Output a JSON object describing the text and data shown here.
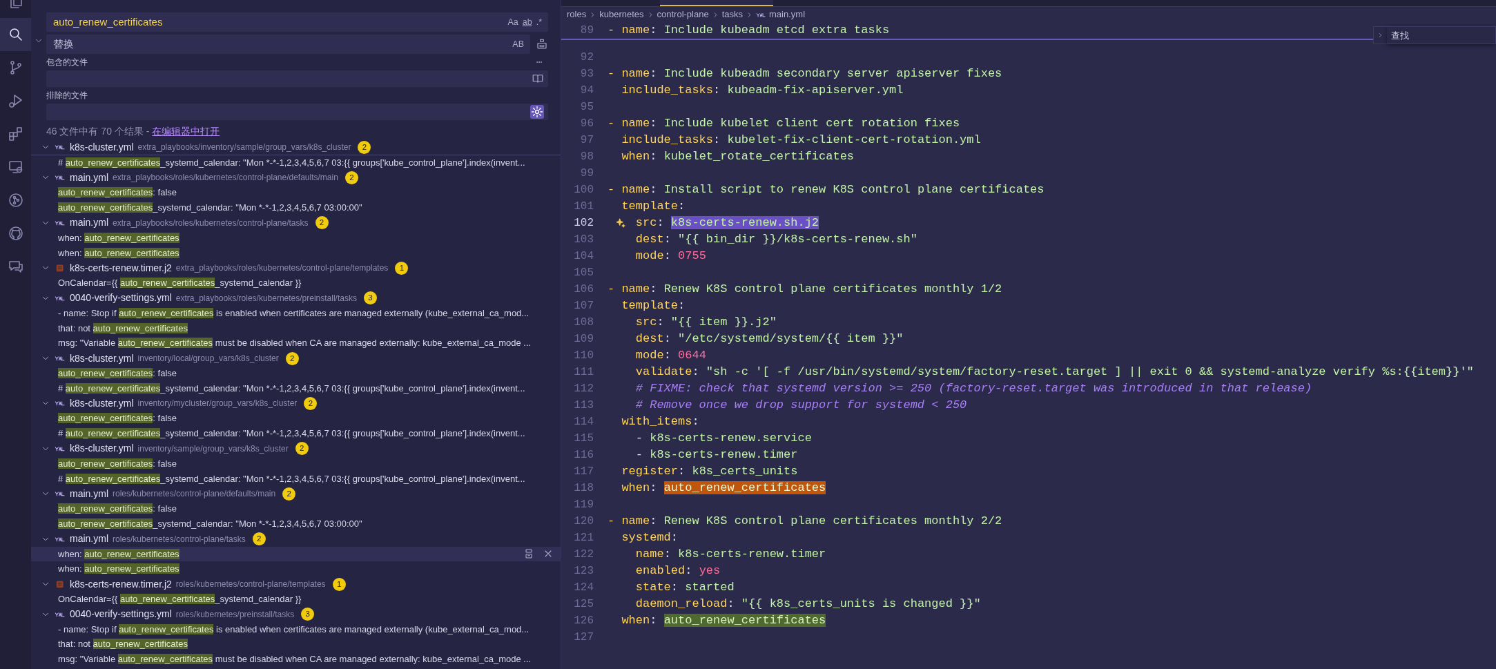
{
  "activity_bar": [
    {
      "kind": "explorer",
      "selected": false
    },
    {
      "kind": "search",
      "selected": true
    },
    {
      "kind": "source_control",
      "selected": false
    },
    {
      "kind": "run_debug",
      "selected": false
    },
    {
      "kind": "extensions",
      "selected": false
    },
    {
      "kind": "remote",
      "selected": false
    },
    {
      "kind": "graph",
      "selected": false
    },
    {
      "kind": "cat",
      "selected": false
    },
    {
      "kind": "chat",
      "selected": false
    }
  ],
  "search": {
    "query": "auto_renew_certificates",
    "query_options": [
      "Aa",
      "ab",
      ".*"
    ],
    "replace_expanded": true,
    "replace_placeholder": "替换",
    "replace_option": "AB",
    "include_label": "包含的文件",
    "exclude_label": "排除的文件",
    "exclude_settings_on": true,
    "summary": "46 文件中有 70 个结果 - ",
    "open_in_editor": "在编辑器中打开"
  },
  "results": [
    {
      "kind": "yaml",
      "name": "k8s-cluster.yml",
      "path": "extra_playbooks/inventory/sample/group_vars/k8s_cluster",
      "count": "2",
      "expanded": true,
      "matches": [
        {
          "before": "# ",
          "match": "auto_renew_certificates",
          "after": "_systemd_calendar: \"Mon *-*-1,2,3,4,5,6,7 03:{{ groups['kube_control_plane'].index(invent...",
          "hovered": false
        }
      ]
    },
    {
      "kind": "yaml",
      "name": "main.yml",
      "path": "extra_playbooks/roles/kubernetes/control-plane/defaults/main",
      "count": "2",
      "expanded": true,
      "matches": [
        {
          "match": "auto_renew_certificates",
          "after": ": false",
          "hovered": false
        },
        {
          "match": "auto_renew_certificates",
          "after": "_systemd_calendar: \"Mon *-*-1,2,3,4,5,6,7 03:00:00\"",
          "hovered": false
        }
      ]
    },
    {
      "kind": "yaml",
      "name": "main.yml",
      "path": "extra_playbooks/roles/kubernetes/control-plane/tasks",
      "count": "2",
      "expanded": true,
      "matches": [
        {
          "before": "when: ",
          "match": "auto_renew_certificates",
          "hovered": false
        },
        {
          "before": "when: ",
          "match": "auto_renew_certificates",
          "hovered": false
        }
      ]
    },
    {
      "kind": "jinja",
      "name": "k8s-certs-renew.timer.j2",
      "path": "extra_playbooks/roles/kubernetes/control-plane/templates",
      "count": "1",
      "expanded": true,
      "matches": [
        {
          "before": "OnCalendar={{ ",
          "match": "auto_renew_certificates",
          "after": "_systemd_calendar }}",
          "hovered": false
        }
      ]
    },
    {
      "kind": "yaml",
      "name": "0040-verify-settings.yml",
      "path": "extra_playbooks/roles/kubernetes/preinstall/tasks",
      "count": "3",
      "expanded": true,
      "matches": [
        {
          "before": "- name: Stop if ",
          "match": "auto_renew_certificates",
          "after": " is enabled when certificates are managed externally (kube_external_ca_mod...",
          "hovered": false
        },
        {
          "before": "that: not ",
          "match": "auto_renew_certificates",
          "hovered": false
        },
        {
          "before": "msg: \"Variable ",
          "match": "auto_renew_certificates",
          "after": " must be disabled when CA are managed externally:  kube_external_ca_mode ...",
          "hovered": false
        }
      ]
    },
    {
      "kind": "yaml",
      "name": "k8s-cluster.yml",
      "path": "inventory/local/group_vars/k8s_cluster",
      "count": "2",
      "expanded": true,
      "matches": [
        {
          "match": "auto_renew_certificates",
          "after": ": false",
          "hovered": false
        },
        {
          "before": "# ",
          "match": "auto_renew_certificates",
          "after": "_systemd_calendar: \"Mon *-*-1,2,3,4,5,6,7 03:{{ groups['kube_control_plane'].index(invent...",
          "hovered": false
        }
      ]
    },
    {
      "kind": "yaml",
      "name": "k8s-cluster.yml",
      "path": "inventory/mycluster/group_vars/k8s_cluster",
      "count": "2",
      "expanded": true,
      "matches": [
        {
          "match": "auto_renew_certificates",
          "after": ": false",
          "hovered": false
        },
        {
          "before": "# ",
          "match": "auto_renew_certificates",
          "after": "_systemd_calendar: \"Mon *-*-1,2,3,4,5,6,7 03:{{ groups['kube_control_plane'].index(invent...",
          "hovered": false
        }
      ]
    },
    {
      "kind": "yaml",
      "name": "k8s-cluster.yml",
      "path": "inventory/sample/group_vars/k8s_cluster",
      "count": "2",
      "expanded": true,
      "matches": [
        {
          "match": "auto_renew_certificates",
          "after": ": false",
          "hovered": false
        },
        {
          "before": "# ",
          "match": "auto_renew_certificates",
          "after": "_systemd_calendar: \"Mon *-*-1,2,3,4,5,6,7 03:{{ groups['kube_control_plane'].index(invent...",
          "hovered": false
        }
      ]
    },
    {
      "kind": "yaml",
      "name": "main.yml",
      "path": "roles/kubernetes/control-plane/defaults/main",
      "count": "2",
      "expanded": true,
      "matches": [
        {
          "match": "auto_renew_certificates",
          "after": ": false",
          "hovered": false
        },
        {
          "match": "auto_renew_certificates",
          "after": "_systemd_calendar: \"Mon *-*-1,2,3,4,5,6,7 03:00:00\"",
          "hovered": false
        }
      ]
    },
    {
      "kind": "yaml",
      "name": "main.yml",
      "path": "roles/kubernetes/control-plane/tasks",
      "count": "2",
      "expanded": true,
      "matches": [
        {
          "before": "when: ",
          "match": "auto_renew_certificates",
          "hovered": true
        },
        {
          "before": "when: ",
          "match": "auto_renew_certificates",
          "hovered": false
        }
      ]
    },
    {
      "kind": "jinja",
      "name": "k8s-certs-renew.timer.j2",
      "path": "roles/kubernetes/control-plane/templates",
      "count": "1",
      "expanded": true,
      "matches": [
        {
          "before": "OnCalendar={{ ",
          "match": "auto_renew_certificates",
          "after": "_systemd_calendar }}",
          "hovered": false
        }
      ]
    },
    {
      "kind": "yaml",
      "name": "0040-verify-settings.yml",
      "path": "roles/kubernetes/preinstall/tasks",
      "count": "3",
      "expanded": true,
      "matches": [
        {
          "before": "- name: Stop if ",
          "match": "auto_renew_certificates",
          "after": " is enabled when certificates are managed externally (kube_external_ca_mod...",
          "hovered": false
        },
        {
          "before": "that: not ",
          "match": "auto_renew_certificates",
          "hovered": false
        },
        {
          "before": "msg: \"Variable ",
          "match": "auto_renew_certificates",
          "after": " must be disabled when CA are managed externally:  kube_external_ca_mode ...",
          "hovered": false
        }
      ]
    }
  ],
  "editor": {
    "breadcrumb": [
      "roles",
      "kubernetes",
      "control-plane",
      "tasks",
      "main.yml"
    ],
    "find_widget": {
      "placeholder": "查找",
      "expanded": false
    },
    "sticky_line": {
      "number": "89",
      "current": false,
      "sparkle": false,
      "tokens": [
        {
          "kind": "key",
          "text": "- name"
        },
        {
          "kind": "plain",
          "text": ": "
        },
        {
          "kind": "value",
          "text": "Include kubeadm etcd extra tasks"
        }
      ]
    },
    "lines": [
      {
        "number": "92",
        "current": false,
        "sparkle": false
      },
      {
        "number": "93",
        "current": false,
        "sparkle": false,
        "tokens": [
          {
            "kind": "key",
            "text": "- name"
          },
          {
            "kind": "plain",
            "text": ": "
          },
          {
            "kind": "value",
            "text": "Include kubeadm secondary server apiserver fixes"
          }
        ]
      },
      {
        "number": "94",
        "current": false,
        "sparkle": false,
        "tokens": [
          {
            "kind": "key",
            "text": "  include_tasks"
          },
          {
            "kind": "plain",
            "text": ": "
          },
          {
            "kind": "value",
            "text": "kubeadm-fix-apiserver.yml"
          }
        ]
      },
      {
        "number": "95",
        "current": false,
        "sparkle": false
      },
      {
        "number": "96",
        "current": false,
        "sparkle": false,
        "tokens": [
          {
            "kind": "key",
            "text": "- name"
          },
          {
            "kind": "plain",
            "text": ": "
          },
          {
            "kind": "value",
            "text": "Include kubelet client cert rotation fixes"
          }
        ]
      },
      {
        "number": "97",
        "current": false,
        "sparkle": false,
        "tokens": [
          {
            "kind": "key",
            "text": "  include_tasks"
          },
          {
            "kind": "plain",
            "text": ": "
          },
          {
            "kind": "value",
            "text": "kubelet-fix-client-cert-rotation.yml"
          }
        ]
      },
      {
        "number": "98",
        "current": false,
        "sparkle": false,
        "tokens": [
          {
            "kind": "key",
            "text": "  when"
          },
          {
            "kind": "plain",
            "text": ": "
          },
          {
            "kind": "value",
            "text": "kubelet_rotate_certificates"
          }
        ]
      },
      {
        "number": "99",
        "current": false,
        "sparkle": false
      },
      {
        "number": "100",
        "current": false,
        "sparkle": false,
        "tokens": [
          {
            "kind": "key",
            "text": "- name"
          },
          {
            "kind": "plain",
            "text": ": "
          },
          {
            "kind": "value",
            "text": "Install script to renew K8S control plane certificates"
          }
        ]
      },
      {
        "number": "101",
        "current": false,
        "sparkle": false,
        "tokens": [
          {
            "kind": "key",
            "text": "  template"
          },
          {
            "kind": "plain",
            "text": ":"
          }
        ]
      },
      {
        "number": "102",
        "current": true,
        "sparkle": true,
        "tokens": [
          {
            "kind": "key",
            "text": "    src"
          },
          {
            "kind": "plain",
            "text": ": "
          },
          {
            "kind": "selection",
            "text": "k8s-certs-renew.sh.j2"
          }
        ]
      },
      {
        "number": "103",
        "current": false,
        "sparkle": false,
        "tokens": [
          {
            "kind": "key",
            "text": "    dest"
          },
          {
            "kind": "plain",
            "text": ": "
          },
          {
            "kind": "value",
            "text": "\"{{ bin_dir }}/k8s-certs-renew.sh\""
          }
        ]
      },
      {
        "number": "104",
        "current": false,
        "sparkle": false,
        "tokens": [
          {
            "kind": "key",
            "text": "    mode"
          },
          {
            "kind": "plain",
            "text": ": "
          },
          {
            "kind": "number",
            "text": "0755"
          }
        ]
      },
      {
        "number": "105",
        "current": false,
        "sparkle": false
      },
      {
        "number": "106",
        "current": false,
        "sparkle": false,
        "tokens": [
          {
            "kind": "key",
            "text": "- name"
          },
          {
            "kind": "plain",
            "text": ": "
          },
          {
            "kind": "value",
            "text": "Renew K8S control plane certificates monthly 1/2"
          }
        ]
      },
      {
        "number": "107",
        "current": false,
        "sparkle": false,
        "tokens": [
          {
            "kind": "key",
            "text": "  template"
          },
          {
            "kind": "plain",
            "text": ":"
          }
        ]
      },
      {
        "number": "108",
        "current": false,
        "sparkle": false,
        "tokens": [
          {
            "kind": "key",
            "text": "    src"
          },
          {
            "kind": "plain",
            "text": ": "
          },
          {
            "kind": "value",
            "text": "\"{{ item }}.j2\""
          }
        ]
      },
      {
        "number": "109",
        "current": false,
        "sparkle": false,
        "tokens": [
          {
            "kind": "key",
            "text": "    dest"
          },
          {
            "kind": "plain",
            "text": ": "
          },
          {
            "kind": "value",
            "text": "\"/etc/systemd/system/{{ item }}\""
          }
        ]
      },
      {
        "number": "110",
        "current": false,
        "sparkle": false,
        "tokens": [
          {
            "kind": "key",
            "text": "    mode"
          },
          {
            "kind": "plain",
            "text": ": "
          },
          {
            "kind": "number",
            "text": "0644"
          }
        ]
      },
      {
        "number": "111",
        "current": false,
        "sparkle": false,
        "tokens": [
          {
            "kind": "key",
            "text": "    validate"
          },
          {
            "kind": "plain",
            "text": ": "
          },
          {
            "kind": "value",
            "text": "\"sh -c '[ -f /usr/bin/systemd/system/factory-reset.target ] || exit 0 && systemd-analyze verify %s:{{item}}'\""
          }
        ]
      },
      {
        "number": "112",
        "current": false,
        "sparkle": false,
        "tokens": [
          {
            "kind": "comment",
            "text": "    # FIXME: check that systemd version >= 250 (factory-reset.target was introduced in that release)"
          }
        ]
      },
      {
        "number": "113",
        "current": false,
        "sparkle": false,
        "tokens": [
          {
            "kind": "comment",
            "text": "    # Remove once we drop support for systemd < 250"
          }
        ]
      },
      {
        "number": "114",
        "current": false,
        "sparkle": false,
        "tokens": [
          {
            "kind": "key",
            "text": "  with_items"
          },
          {
            "kind": "plain",
            "text": ":"
          }
        ]
      },
      {
        "number": "115",
        "current": false,
        "sparkle": false,
        "tokens": [
          {
            "kind": "plain",
            "text": "    - "
          },
          {
            "kind": "value",
            "text": "k8s-certs-renew.service"
          }
        ]
      },
      {
        "number": "116",
        "current": false,
        "sparkle": false,
        "tokens": [
          {
            "kind": "plain",
            "text": "    - "
          },
          {
            "kind": "value",
            "text": "k8s-certs-renew.timer"
          }
        ]
      },
      {
        "number": "117",
        "current": false,
        "sparkle": false,
        "tokens": [
          {
            "kind": "key",
            "text": "  register"
          },
          {
            "kind": "plain",
            "text": ": "
          },
          {
            "kind": "value",
            "text": "k8s_certs_units"
          }
        ]
      },
      {
        "number": "118",
        "current": false,
        "sparkle": false,
        "tokens": [
          {
            "kind": "key",
            "text": "  when"
          },
          {
            "kind": "plain",
            "text": ": "
          },
          {
            "kind": "current_match",
            "text": "auto_renew_certificates"
          }
        ]
      },
      {
        "number": "119",
        "current": false,
        "sparkle": false
      },
      {
        "number": "120",
        "current": false,
        "sparkle": false,
        "tokens": [
          {
            "kind": "key",
            "text": "- name"
          },
          {
            "kind": "plain",
            "text": ": "
          },
          {
            "kind": "value",
            "text": "Renew K8S control plane certificates monthly 2/2"
          }
        ]
      },
      {
        "number": "121",
        "current": false,
        "sparkle": false,
        "tokens": [
          {
            "kind": "key",
            "text": "  systemd"
          },
          {
            "kind": "plain",
            "text": ":"
          }
        ]
      },
      {
        "number": "122",
        "current": false,
        "sparkle": false,
        "tokens": [
          {
            "kind": "key",
            "text": "    name"
          },
          {
            "kind": "plain",
            "text": ": "
          },
          {
            "kind": "value",
            "text": "k8s-certs-renew.timer"
          }
        ]
      },
      {
        "number": "123",
        "current": false,
        "sparkle": false,
        "tokens": [
          {
            "kind": "key",
            "text": "    enabled"
          },
          {
            "kind": "plain",
            "text": ": "
          },
          {
            "kind": "number",
            "text": "yes"
          }
        ]
      },
      {
        "number": "124",
        "current": false,
        "sparkle": false,
        "tokens": [
          {
            "kind": "key",
            "text": "    state"
          },
          {
            "kind": "plain",
            "text": ": "
          },
          {
            "kind": "value",
            "text": "started"
          }
        ]
      },
      {
        "number": "125",
        "current": false,
        "sparkle": false,
        "tokens": [
          {
            "kind": "key",
            "text": "    daemon_reload"
          },
          {
            "kind": "plain",
            "text": ": "
          },
          {
            "kind": "value",
            "text": "\"{{ k8s_certs_units is changed }}\""
          }
        ]
      },
      {
        "number": "126",
        "current": false,
        "sparkle": false,
        "tokens": [
          {
            "kind": "key",
            "text": "  when"
          },
          {
            "kind": "plain",
            "text": ": "
          },
          {
            "kind": "match",
            "text": "auto_renew_certificates"
          }
        ]
      },
      {
        "number": "127",
        "current": false,
        "sparkle": false
      }
    ]
  }
}
